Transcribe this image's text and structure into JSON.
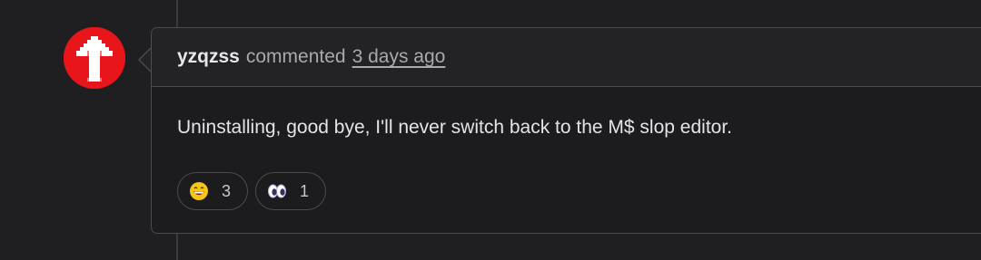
{
  "comment": {
    "author": "yzqzss",
    "action": "commented",
    "timestamp": "3 days ago",
    "body": "Uninstalling, good bye, I'll never switch back to the M$ slop editor."
  },
  "reactions": [
    {
      "emoji": "grinning-face-icon",
      "count": "3"
    },
    {
      "emoji": "eyes-icon",
      "count": "1"
    }
  ],
  "colors": {
    "avatar_bg": "#e8161b",
    "page_bg": "#1f1f21"
  }
}
